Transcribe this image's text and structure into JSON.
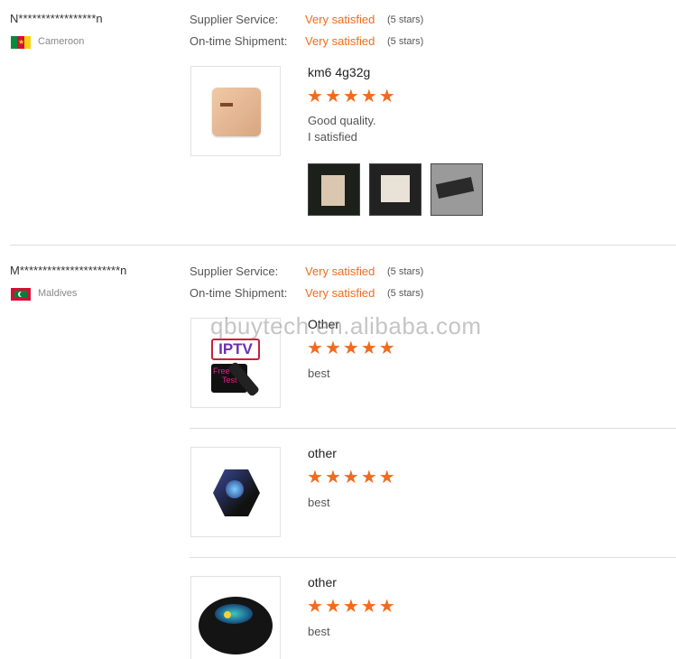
{
  "reviews": [
    {
      "reviewer": "N*****************n",
      "country": "Cameroon",
      "supplier_label": "Supplier Service:",
      "supplier_value": "Very satisfied",
      "supplier_stars": "(5 stars)",
      "shipment_label": "On-time Shipment:",
      "shipment_value": "Very satisfied",
      "shipment_stars": "(5 stars)",
      "items": [
        {
          "title": "km6 4g32g",
          "rating": 5,
          "comment_lines": [
            "Good quality.",
            "I satisfied"
          ]
        }
      ]
    },
    {
      "reviewer": "M**********************n",
      "country": "Maldives",
      "supplier_label": "Supplier Service:",
      "supplier_value": "Very satisfied",
      "supplier_stars": "(5 stars)",
      "shipment_label": "On-time Shipment:",
      "shipment_value": "Very satisfied",
      "shipment_stars": "(5 stars)",
      "items": [
        {
          "title": "Other",
          "rating": 5,
          "comment": "best",
          "image_text": [
            "IPTV",
            "Free",
            "Test"
          ]
        },
        {
          "title": "other",
          "rating": 5,
          "comment": "best"
        },
        {
          "title": "other",
          "rating": 5,
          "comment": "best"
        }
      ]
    }
  ],
  "watermark": "qbuytech.en.alibaba.com",
  "star_glyph": "★",
  "accent_color": "#f26b1d"
}
